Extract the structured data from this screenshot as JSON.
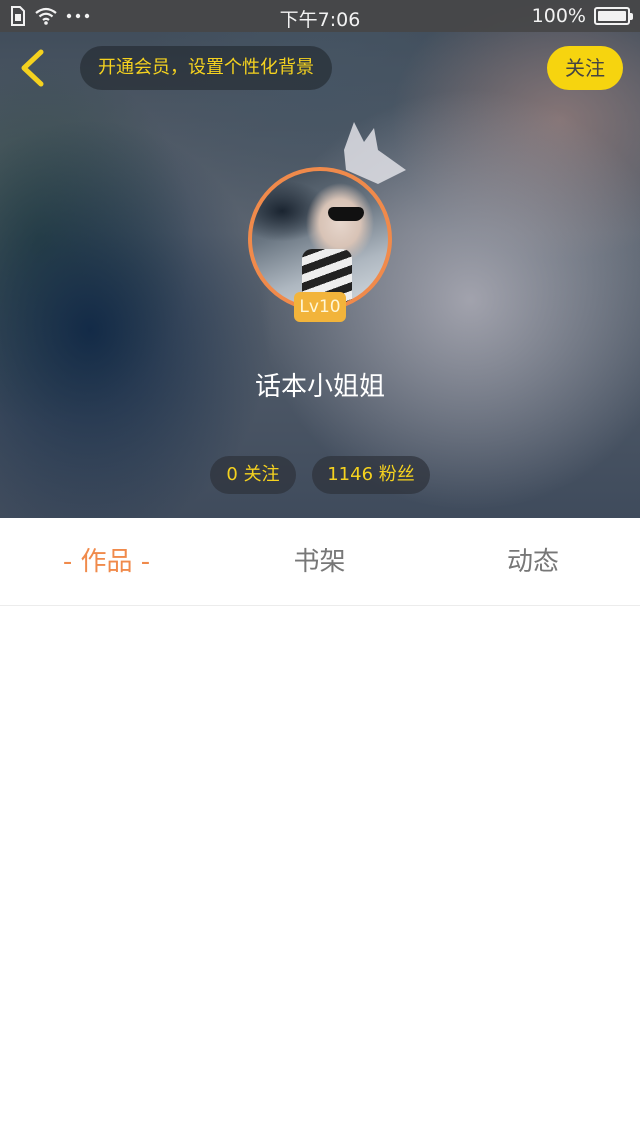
{
  "status_bar": {
    "time": "下午7:06",
    "battery": "100%",
    "icons": [
      "sim-icon",
      "wifi-icon",
      "more-dots-icon",
      "battery-icon"
    ]
  },
  "header": {
    "vip_promo": "开通会员，设置个性化背景",
    "follow_label": "关注",
    "level": "Lv10",
    "username": "话本小姐姐",
    "following": "0 关注",
    "fans": "1146 粉丝"
  },
  "tabs": [
    {
      "label": "- 作品 -",
      "active": true
    },
    {
      "label": "书架",
      "active": false
    },
    {
      "label": "动态",
      "active": false
    }
  ],
  "colors": {
    "accent_orange": "#f08a4b",
    "accent_yellow": "#f5d21f",
    "follow_button": "#f6d40f",
    "level_badge": "#f2b43b"
  }
}
